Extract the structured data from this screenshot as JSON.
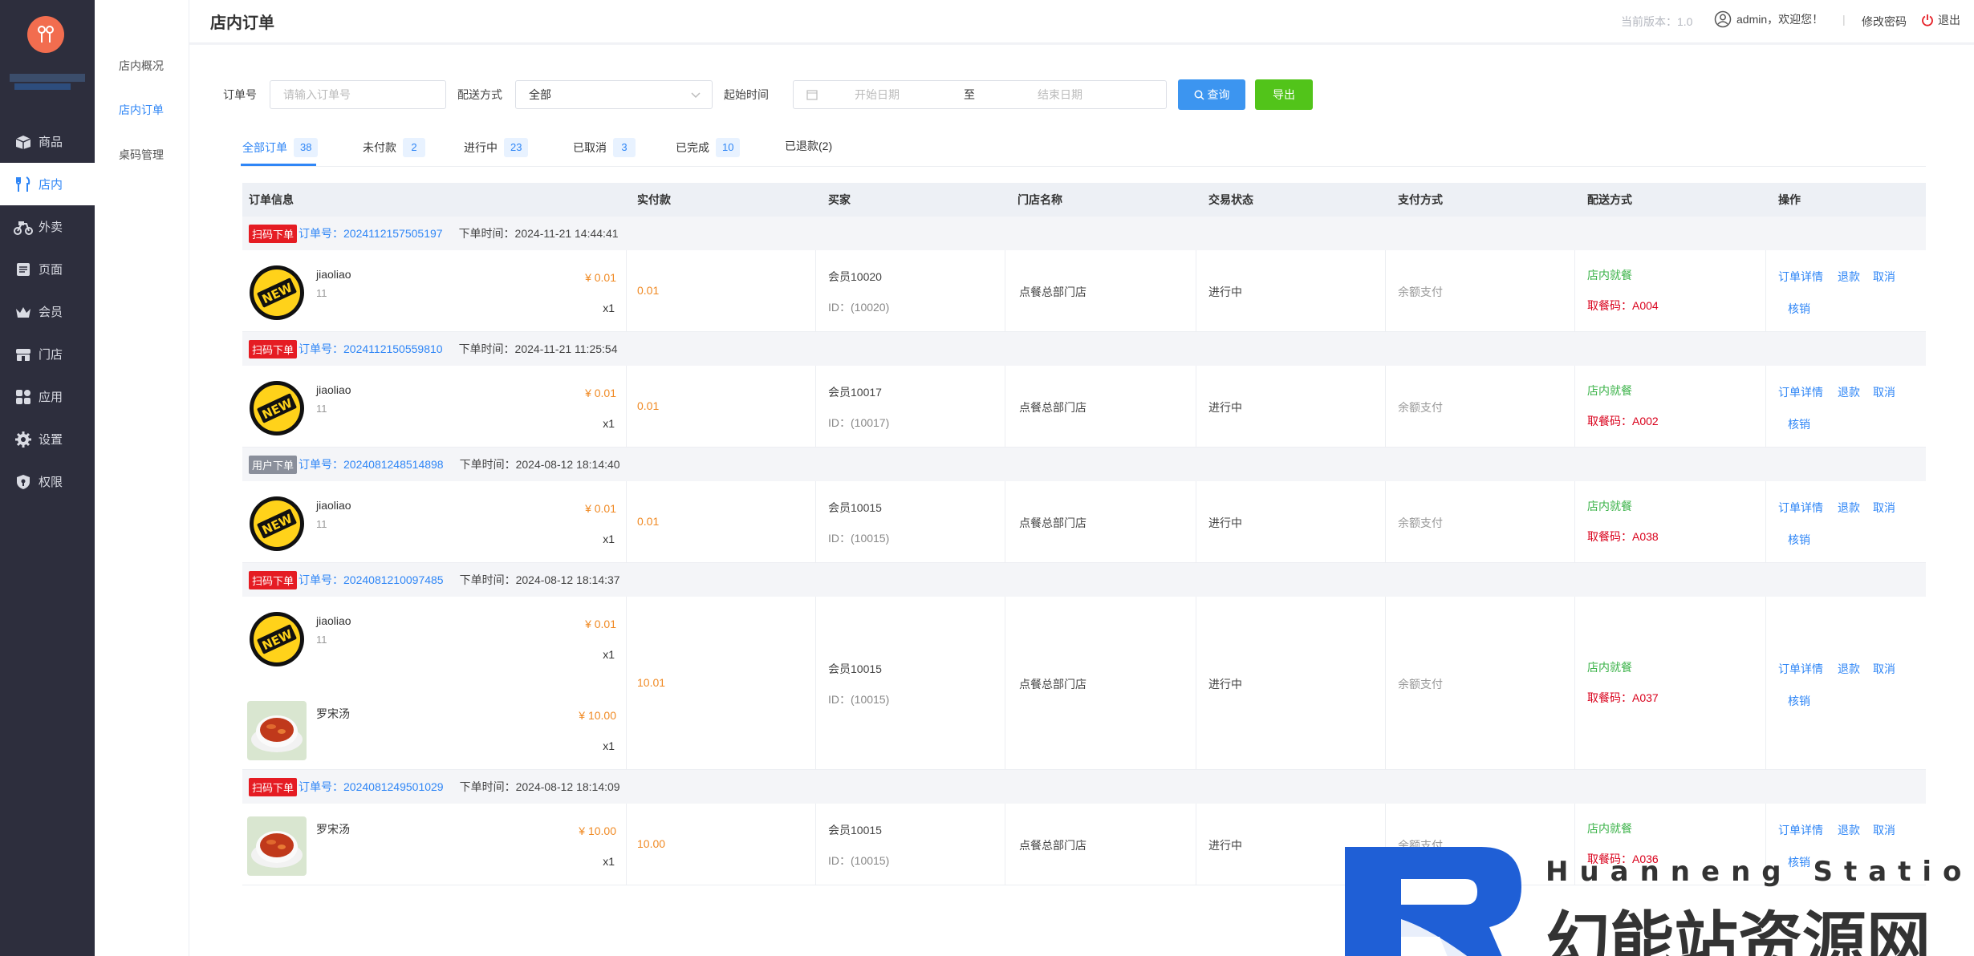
{
  "sidebar": {
    "items": [
      {
        "label": "商品",
        "icon": "box-icon"
      },
      {
        "label": "店内",
        "icon": "utensils-icon"
      },
      {
        "label": "外卖",
        "icon": "scooter-icon"
      },
      {
        "label": "页面",
        "icon": "page-icon"
      },
      {
        "label": "会员",
        "icon": "crown-icon"
      },
      {
        "label": "门店",
        "icon": "store-icon"
      },
      {
        "label": "应用",
        "icon": "apps-icon"
      },
      {
        "label": "设置",
        "icon": "gear-icon"
      },
      {
        "label": "权限",
        "icon": "shield-icon"
      }
    ]
  },
  "submenu": {
    "items": [
      {
        "label": "店内概况"
      },
      {
        "label": "店内订单"
      },
      {
        "label": "桌码管理"
      }
    ]
  },
  "header": {
    "title": "店内订单",
    "version": "当前版本：1.0",
    "user": "admin，欢迎您！",
    "separator": "|",
    "change_password": "修改密码",
    "logout": "退出"
  },
  "filters": {
    "order_no_label": "订单号",
    "order_no_placeholder": "请输入订单号",
    "delivery_label": "配送方式",
    "delivery_value": "全部",
    "time_label": "起始时间",
    "start_placeholder": "开始日期",
    "to": "至",
    "end_placeholder": "结束日期",
    "query": "查询",
    "export": "导出"
  },
  "tabs": [
    {
      "label": "全部订单",
      "count": "38"
    },
    {
      "label": "未付款",
      "count": "2"
    },
    {
      "label": "进行中",
      "count": "23"
    },
    {
      "label": "已取消",
      "count": "3"
    },
    {
      "label": "已完成",
      "count": "10"
    },
    {
      "label": "已退款(2)",
      "count": ""
    }
  ],
  "table": {
    "columns": [
      "订单信息",
      "实付款",
      "买家",
      "门店名称",
      "交易状态",
      "支付方式",
      "配送方式",
      "操作"
    ]
  },
  "orders": [
    {
      "tag": "扫码下单",
      "no": "订单号：2024112157505197",
      "time": "下单时间：2024-11-21 14:44:41",
      "products": [
        {
          "name": "jiaoliao",
          "spec": "11",
          "price": "¥ 0.01",
          "qty": "x1",
          "img": "new-badge"
        }
      ],
      "paid": "0.01",
      "buyer": "会员10020",
      "buyer_id": "ID：(10020)",
      "store": "点餐总部门店",
      "status": "进行中",
      "pay_method": "余额支付",
      "delivery": "店内就餐",
      "code": "取餐码：A004",
      "ops": [
        "订单详情",
        "退款",
        "取消",
        "核销"
      ]
    },
    {
      "tag": "扫码下单",
      "no": "订单号：2024112150559810",
      "time": "下单时间：2024-11-21 11:25:54",
      "products": [
        {
          "name": "jiaoliao",
          "spec": "11",
          "price": "¥ 0.01",
          "qty": "x1",
          "img": "new-badge"
        }
      ],
      "paid": "0.01",
      "buyer": "会员10017",
      "buyer_id": "ID：(10017)",
      "store": "点餐总部门店",
      "status": "进行中",
      "pay_method": "余额支付",
      "delivery": "店内就餐",
      "code": "取餐码：A002",
      "ops": [
        "订单详情",
        "退款",
        "取消",
        "核销"
      ]
    },
    {
      "tag": "用户下单",
      "no": "订单号：2024081248514898",
      "time": "下单时间：2024-08-12 18:14:40",
      "products": [
        {
          "name": "jiaoliao",
          "spec": "11",
          "price": "¥ 0.01",
          "qty": "x1",
          "img": "new-badge"
        }
      ],
      "paid": "0.01",
      "buyer": "会员10015",
      "buyer_id": "ID：(10015)",
      "store": "点餐总部门店",
      "status": "进行中",
      "pay_method": "余额支付",
      "delivery": "店内就餐",
      "code": "取餐码：A038",
      "ops": [
        "订单详情",
        "退款",
        "取消",
        "核销"
      ]
    },
    {
      "tag": "扫码下单",
      "no": "订单号：2024081210097485",
      "time": "下单时间：2024-08-12 18:14:37",
      "products": [
        {
          "name": "jiaoliao",
          "spec": "11",
          "price": "¥ 0.01",
          "qty": "x1",
          "img": "new-badge"
        },
        {
          "name": "罗宋汤",
          "spec": "",
          "price": "¥ 10.00",
          "qty": "x1",
          "img": "soup"
        }
      ],
      "paid": "10.01",
      "buyer": "会员10015",
      "buyer_id": "ID：(10015)",
      "store": "点餐总部门店",
      "status": "进行中",
      "pay_method": "余额支付",
      "delivery": "店内就餐",
      "code": "取餐码：A037",
      "ops": [
        "订单详情",
        "退款",
        "取消",
        "核销"
      ]
    },
    {
      "tag": "扫码下单",
      "no": "订单号：2024081249501029",
      "time": "下单时间：2024-08-12 18:14:09",
      "products": [
        {
          "name": "罗宋汤",
          "spec": "",
          "price": "¥ 10.00",
          "qty": "x1",
          "img": "soup"
        }
      ],
      "paid": "10.00",
      "buyer": "会员10015",
      "buyer_id": "ID：(10015)",
      "store": "点餐总部门店",
      "status": "进行中",
      "pay_method": "余额支付",
      "delivery": "店内就餐",
      "code": "取餐码：A036",
      "ops": [
        "订单详情",
        "退款",
        "取消",
        "核销"
      ]
    }
  ],
  "watermark": {
    "top": "Huanneng Station",
    "main": "幻能站资源网"
  }
}
